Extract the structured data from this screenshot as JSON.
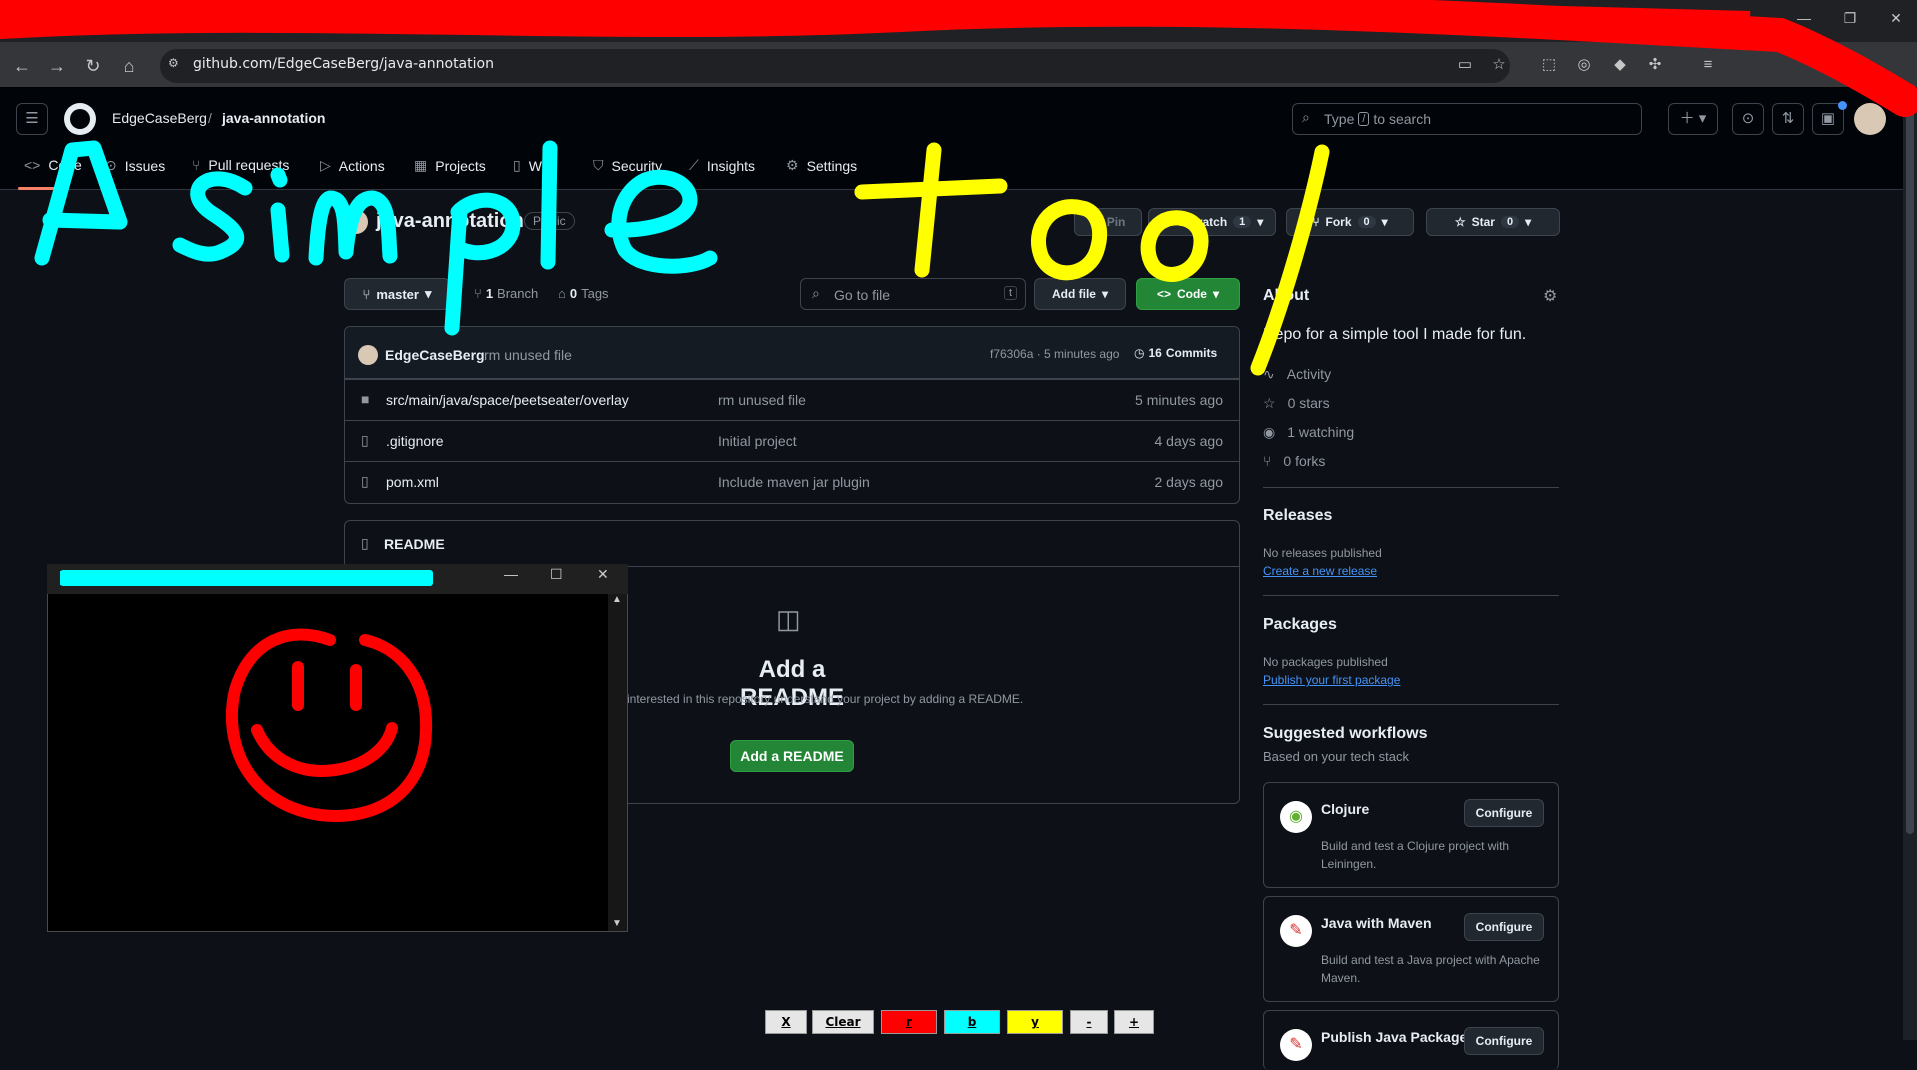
{
  "browser": {
    "url": "github.com/EdgeCaseBerg/java-annotation",
    "nav_icons": [
      "back-arrow-icon",
      "forward-arrow-icon",
      "reload-icon",
      "home-icon"
    ]
  },
  "header": {
    "owner": "EdgeCaseBerg",
    "separator": "/",
    "repo": "java-annotation",
    "search_placeholder_pre": "Type",
    "search_key": "/",
    "search_placeholder_post": "to search"
  },
  "repo_tabs": [
    {
      "label": "Code",
      "icon": "code-icon"
    },
    {
      "label": "Issues",
      "icon": "issue-icon"
    },
    {
      "label": "Pull requests",
      "icon": "pull-request-icon"
    },
    {
      "label": "Actions",
      "icon": "play-icon"
    },
    {
      "label": "Projects",
      "icon": "table-icon"
    },
    {
      "label": "Wiki",
      "icon": "book-icon"
    },
    {
      "label": "Security",
      "icon": "shield-icon"
    },
    {
      "label": "Insights",
      "icon": "graph-icon"
    },
    {
      "label": "Settings",
      "icon": "gear-icon"
    }
  ],
  "repo_head": {
    "title": "java-annotation",
    "visibility": "Public",
    "pin": "Pin",
    "unwatch": "Unwatch",
    "watch_count": "1",
    "fork": "Fork",
    "fork_count": "0",
    "star": "Star",
    "star_count": "0"
  },
  "toolbar": {
    "branch": "master",
    "branches_count": "1",
    "branches_label": "Branch",
    "tags_count": "0",
    "tags_label": "Tags",
    "goto_placeholder": "Go to file",
    "goto_key": "t",
    "add_file": "Add file",
    "code": "Code"
  },
  "commit": {
    "author": "EdgeCaseBerg",
    "message": "rm unused file",
    "hash_time": "f76306a · 5 minutes ago",
    "commits_count": "16",
    "commits_label": "Commits"
  },
  "files": [
    {
      "name": "src/main/java/space/peetseater/overlay",
      "message": "rm unused file",
      "age": "5 minutes ago",
      "type": "folder"
    },
    {
      "name": ".gitignore",
      "message": "Initial project",
      "age": "4 days ago",
      "type": "file"
    },
    {
      "name": "pom.xml",
      "message": "Include maven jar plugin",
      "age": "2 days ago",
      "type": "file"
    }
  ],
  "readme": {
    "header": "README",
    "title": "Add a README",
    "desc": "interested in this repository understand your project by adding a README.",
    "button": "Add a README"
  },
  "about": {
    "heading": "About",
    "description": "Repo for a simple tool I made for fun.",
    "stats": [
      {
        "label": "Activity",
        "icon": "pulse-icon"
      },
      {
        "label": "0 stars",
        "icon": "star-icon"
      },
      {
        "label": "1 watching",
        "icon": "eye-icon"
      },
      {
        "label": "0 forks",
        "icon": "fork-icon"
      }
    ]
  },
  "releases": {
    "heading": "Releases",
    "text": "No releases published",
    "link": "Create a new release"
  },
  "packages": {
    "heading": "Packages",
    "text": "No packages published",
    "link": "Publish your first package"
  },
  "workflows": {
    "heading": "Suggested workflows",
    "sub": "Based on your tech stack",
    "items": [
      {
        "name": "Clojure",
        "desc": "Build and test a Clojure project with Leiningen.",
        "button": "Configure"
      },
      {
        "name": "Java with Maven",
        "desc": "Build and test a Java project with Apache Maven.",
        "button": "Configure"
      },
      {
        "name": "Publish Java Package",
        "desc": "",
        "button": "Configure"
      }
    ]
  },
  "overlay_palette": {
    "buttons": [
      {
        "label": "X",
        "bg": "#e6e6e6"
      },
      {
        "label": "Clear",
        "bg": "#e6e6e6"
      },
      {
        "label": "r",
        "bg": "#ff0000"
      },
      {
        "label": "b",
        "bg": "#00ffff"
      },
      {
        "label": "y",
        "bg": "#ffff00"
      },
      {
        "label": "-",
        "bg": "#e6e6e6"
      },
      {
        "label": "+",
        "bg": "#e6e6e6"
      }
    ]
  },
  "annotation_text": "A simple tool",
  "colors": {
    "annotation_red": "#ff0000",
    "annotation_cyan": "#00ffff",
    "annotation_yellow": "#ffff00",
    "primary_green": "#238636"
  }
}
